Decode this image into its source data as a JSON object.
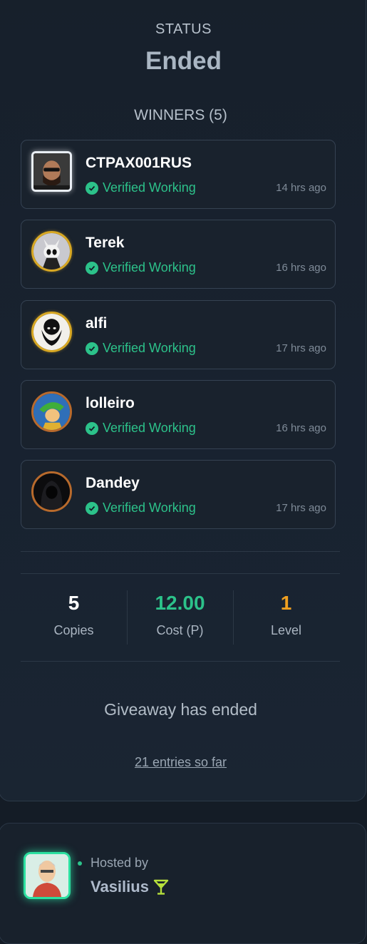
{
  "status": {
    "label": "STATUS",
    "value": "Ended"
  },
  "winners": {
    "title": "WINNERS (5)",
    "items": [
      {
        "name": "CTPAX001RUS",
        "verified": "Verified Working",
        "time": "14 hrs ago"
      },
      {
        "name": "Terek",
        "verified": "Verified Working",
        "time": "16 hrs ago"
      },
      {
        "name": "alfi",
        "verified": "Verified Working",
        "time": "17 hrs ago"
      },
      {
        "name": "lolleiro",
        "verified": "Verified Working",
        "time": "16 hrs ago"
      },
      {
        "name": "Dandey",
        "verified": "Verified Working",
        "time": "17 hrs ago"
      }
    ]
  },
  "stats": {
    "copies": {
      "value": "5",
      "label": "Copies",
      "color": "#ffffff"
    },
    "cost": {
      "value": "12.00",
      "label": "Cost (P)",
      "color": "#2cc28a"
    },
    "level": {
      "value": "1",
      "label": "Level",
      "color": "#f0a020"
    }
  },
  "giveaway": {
    "ended_message": "Giveaway has ended",
    "entries_link": "21 entries so far"
  },
  "host": {
    "label": "Hosted by",
    "name": "Vasilius"
  },
  "colors": {
    "verified": "#2cc28a",
    "accent_gold": "#d8a823",
    "host_glow": "#2be0a0"
  }
}
